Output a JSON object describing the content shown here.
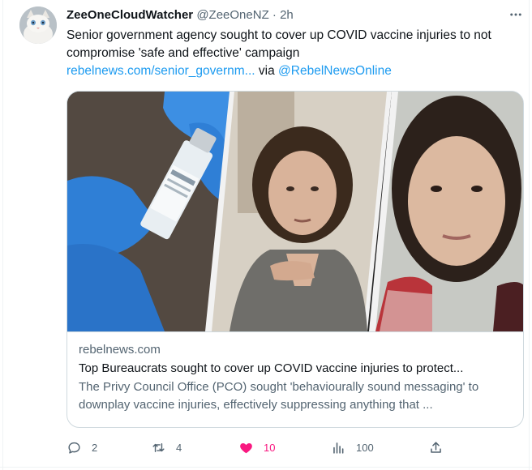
{
  "tweet": {
    "author_name": "ZeeOneCloudWatcher",
    "author_handle": "@ZeeOneNZ",
    "separator": "·",
    "time": "2h",
    "text_line": "Senior government agency sought to cover up COVID vaccine injuries to not compromise 'safe and effective' campaign",
    "link_text": "rebelnews.com/senior_governm...",
    "via_text": " via ",
    "mention": "@RebelNewsOnline"
  },
  "card": {
    "domain": "rebelnews.com",
    "title": "Top Bureaucrats sought to cover up COVID vaccine injuries to protect...",
    "description": "The Privy Council Office (PCO) sought 'behaviourally sound messaging' to downplay vaccine injuries, effectively suppressing anything that ..."
  },
  "actions": {
    "replies": "2",
    "retweets": "4",
    "likes": "10",
    "views": "100"
  },
  "colors": {
    "link": "#1d9bf0",
    "like": "#f91880",
    "secondary_text": "#536471",
    "border": "#cfd9de"
  },
  "icons": [
    "more-icon",
    "reply-icon",
    "retweet-icon",
    "like-icon",
    "views-icon",
    "share-icon"
  ]
}
